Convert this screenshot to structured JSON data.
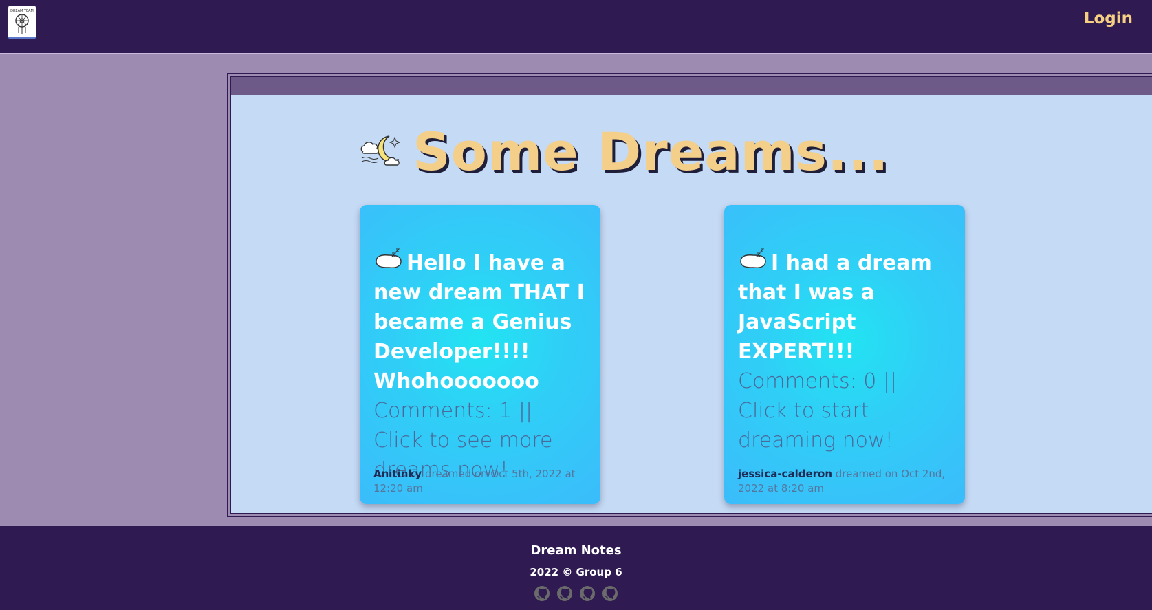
{
  "header": {
    "logo_icon": "dream-catcher-logo-icon",
    "logo_text": "DREAM TEAM",
    "login_label": "Login"
  },
  "main": {
    "title": "Some Dreams...",
    "title_icon": "moon-cloud-icon",
    "cards": [
      {
        "icon": "pillow-icon",
        "title": "Hello I have a new dream THAT I became a Genius Developer!!!! Whohooooooo",
        "comments": "Comments: 1 || Click to see more dreams now!",
        "author": "Anitinky",
        "dated": "dreamed on Oct 5th, 2022 at 12:20 am"
      },
      {
        "icon": "pillow-icon",
        "title": "I had a dream that I was a JavaScript EXPERT!!!",
        "comments": "Comments: 0 || Click to start dreaming now!",
        "author": "jessica-calderon",
        "dated": "dreamed on Oct 2nd, 2022 at 8:20 am"
      }
    ]
  },
  "footer": {
    "title": "Dream Notes",
    "copyright": "2022 © Group 6",
    "icons": [
      "github-icon",
      "github-icon",
      "github-icon",
      "github-icon"
    ]
  },
  "colors": {
    "header_bg": "#2f1a51",
    "page_bg": "#9d8bb2",
    "panel_bg": "#c5daf5",
    "accent": "#f5cf82",
    "card_center": "#22e4f2",
    "card_edge": "#3bbcfb"
  }
}
